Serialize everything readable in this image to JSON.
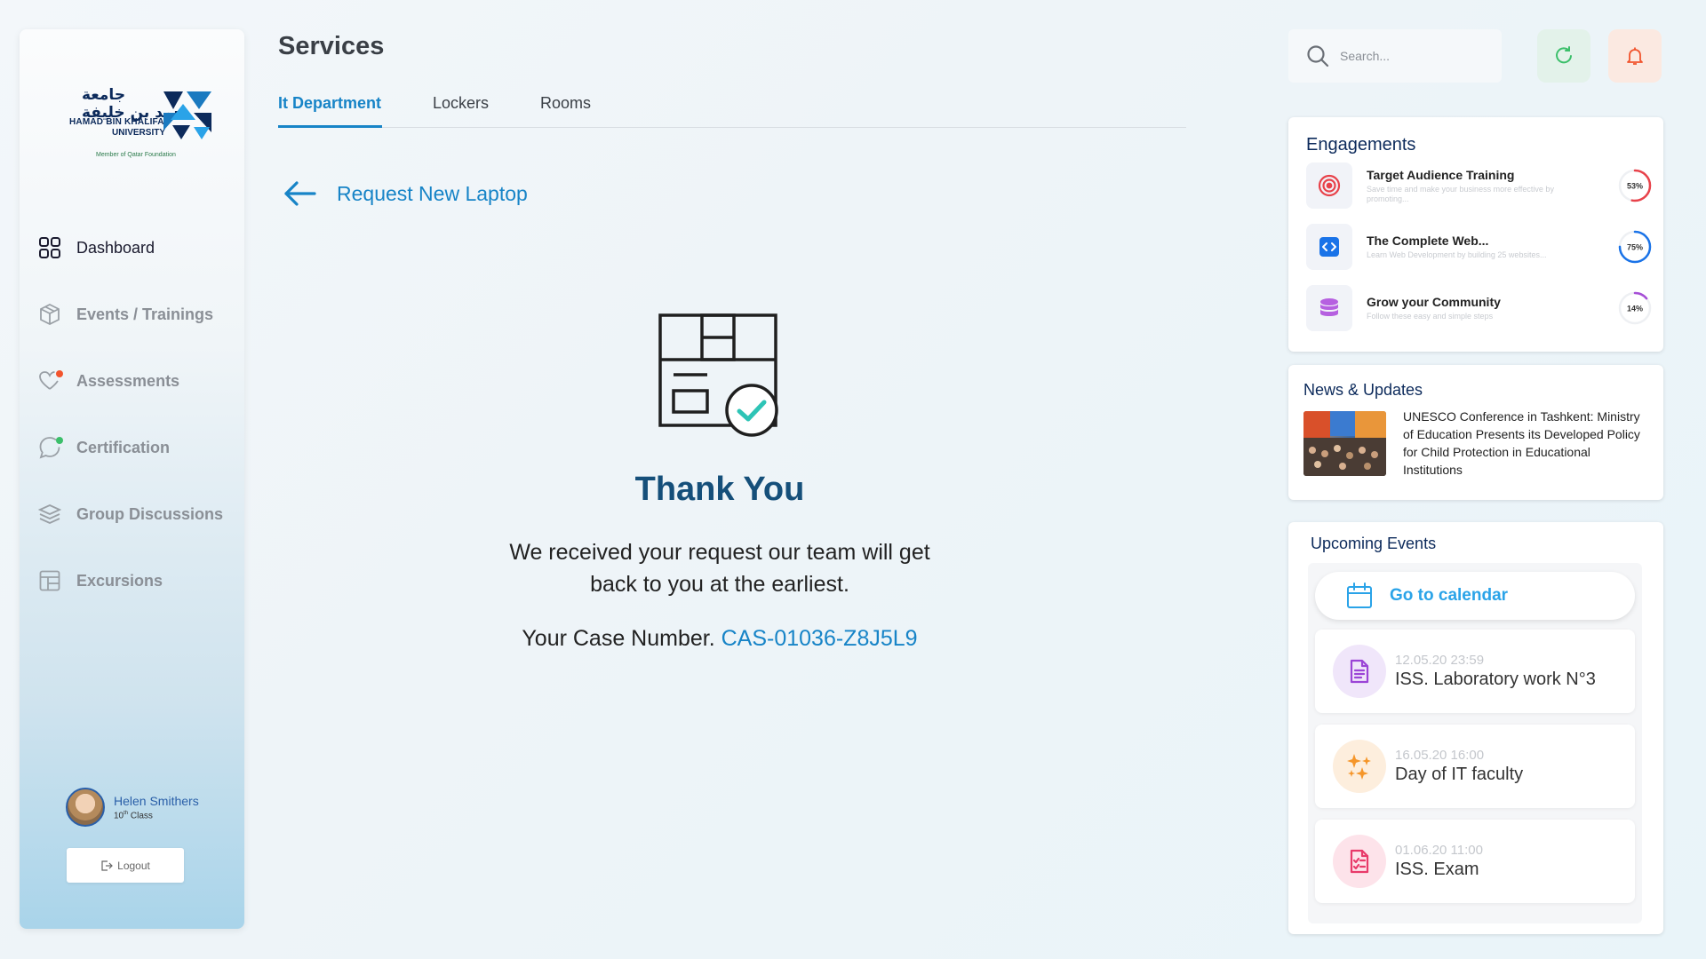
{
  "sidebar": {
    "logo": {
      "arabic_line1": "جامعة",
      "arabic_line2": "حمد بن خليفة",
      "english_line1": "HAMAD BIN KHALIFA",
      "english_line2": "UNIVERSITY",
      "member": "Member of Qatar Foundation"
    },
    "nav": [
      {
        "label": "Dashboard",
        "icon": "grid-icon",
        "active": true
      },
      {
        "label": "Events / Trainings",
        "icon": "box-icon"
      },
      {
        "label": "Assessments",
        "icon": "heart-icon",
        "dot_color": "#f2542d"
      },
      {
        "label": "Certification",
        "icon": "chat-icon",
        "dot_color": "#3bbf6a"
      },
      {
        "label": "Group Discussions",
        "icon": "layers-icon"
      },
      {
        "label": "Excursions",
        "icon": "layout-icon"
      }
    ],
    "user": {
      "name": "Helen Smithers",
      "class_num": "10",
      "class_sup": "th",
      "class_label": " Class"
    },
    "logout_label": "Logout"
  },
  "main": {
    "title": "Services",
    "tabs": [
      {
        "label": "It Department",
        "active": true
      },
      {
        "label": "Lockers"
      },
      {
        "label": "Rooms"
      }
    ],
    "request_title": "Request New Laptop",
    "thank_title": "Thank You",
    "message": "We received your request our team will get back to you at the earliest.",
    "case_label": "Your Case Number.",
    "case_number": "CAS-01036-Z8J5L9"
  },
  "right": {
    "search_placeholder": "Search...",
    "engagements": {
      "title": "Engagements",
      "items": [
        {
          "title": "Target Audience Training",
          "subtitle": "Save time and make your business more effective by promoting...",
          "percent": 53,
          "percent_label": "53%",
          "color": "#e8424a",
          "icon": "target-icon"
        },
        {
          "title": "The Complete Web...",
          "subtitle": "Learn Web Development by building 25 websites...",
          "percent": 75,
          "percent_label": "75%",
          "color": "#1a73e8",
          "icon": "code-icon"
        },
        {
          "title": "Grow your Community",
          "subtitle": "Follow these easy and simple steps",
          "percent": 14,
          "percent_label": "14%",
          "color": "#a64fd6",
          "icon": "database-icon"
        }
      ]
    },
    "news": {
      "title": "News & Updates",
      "headline": "UNESCO Conference in Tashkent: Ministry of Education Presents its Developed Policy for Child Protection in Educational Institutions"
    },
    "events": {
      "title": "Upcoming Events",
      "calendar_label": "Go to calendar",
      "items": [
        {
          "date": "12.05.20 23:59",
          "name": "ISS. Laboratory work N°3",
          "icon": "document-icon",
          "bg": "#f0e6fa",
          "fg": "#9b44d6"
        },
        {
          "date": "16.05.20 16:00",
          "name": "Day of IT faculty",
          "icon": "sparkles-icon",
          "bg": "#fdeedd",
          "fg": "#f5962a"
        },
        {
          "date": "01.06.20 11:00",
          "name": "ISS. Exam",
          "icon": "checklist-icon",
          "bg": "#fde3ea",
          "fg": "#e83a6a"
        }
      ]
    }
  }
}
